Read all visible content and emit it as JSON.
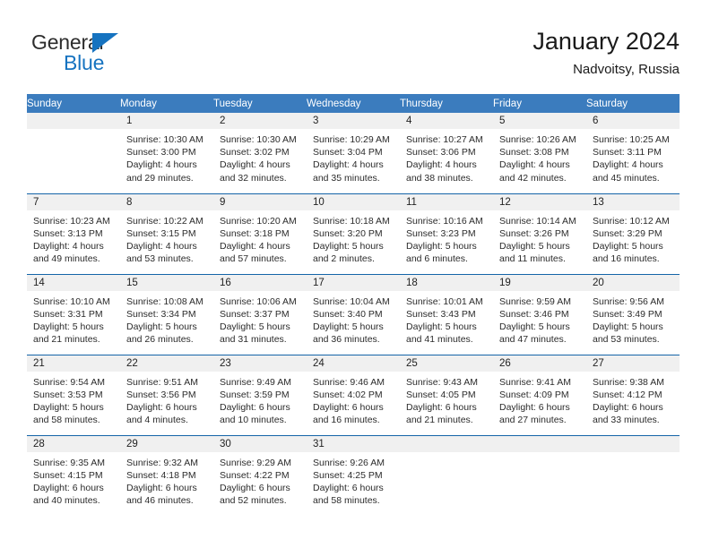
{
  "brand": {
    "line1": "General",
    "line2": "Blue",
    "accent_color": "#1673c0",
    "triangle_icon": "brand-triangle-icon"
  },
  "header": {
    "title": "January 2024",
    "subtitle": "Nadvoitsy, Russia"
  },
  "calendar": {
    "header_bg": "#3b7cbe",
    "row_divider_color": "#1565a8",
    "daynum_band_bg": "#f0f0f0",
    "weekday_headers": [
      "Sunday",
      "Monday",
      "Tuesday",
      "Wednesday",
      "Thursday",
      "Friday",
      "Saturday"
    ],
    "labels": {
      "sunrise": "Sunrise:",
      "sunset": "Sunset:",
      "daylight": "Daylight:"
    },
    "weeks": [
      [
        {
          "day": "",
          "empty": true
        },
        {
          "day": "1",
          "sunrise": "Sunrise: 10:30 AM",
          "sunset": "Sunset: 3:00 PM",
          "daylight_1": "Daylight: 4 hours",
          "daylight_2": "and 29 minutes."
        },
        {
          "day": "2",
          "sunrise": "Sunrise: 10:30 AM",
          "sunset": "Sunset: 3:02 PM",
          "daylight_1": "Daylight: 4 hours",
          "daylight_2": "and 32 minutes."
        },
        {
          "day": "3",
          "sunrise": "Sunrise: 10:29 AM",
          "sunset": "Sunset: 3:04 PM",
          "daylight_1": "Daylight: 4 hours",
          "daylight_2": "and 35 minutes."
        },
        {
          "day": "4",
          "sunrise": "Sunrise: 10:27 AM",
          "sunset": "Sunset: 3:06 PM",
          "daylight_1": "Daylight: 4 hours",
          "daylight_2": "and 38 minutes."
        },
        {
          "day": "5",
          "sunrise": "Sunrise: 10:26 AM",
          "sunset": "Sunset: 3:08 PM",
          "daylight_1": "Daylight: 4 hours",
          "daylight_2": "and 42 minutes."
        },
        {
          "day": "6",
          "sunrise": "Sunrise: 10:25 AM",
          "sunset": "Sunset: 3:11 PM",
          "daylight_1": "Daylight: 4 hours",
          "daylight_2": "and 45 minutes."
        }
      ],
      [
        {
          "day": "7",
          "sunrise": "Sunrise: 10:23 AM",
          "sunset": "Sunset: 3:13 PM",
          "daylight_1": "Daylight: 4 hours",
          "daylight_2": "and 49 minutes."
        },
        {
          "day": "8",
          "sunrise": "Sunrise: 10:22 AM",
          "sunset": "Sunset: 3:15 PM",
          "daylight_1": "Daylight: 4 hours",
          "daylight_2": "and 53 minutes."
        },
        {
          "day": "9",
          "sunrise": "Sunrise: 10:20 AM",
          "sunset": "Sunset: 3:18 PM",
          "daylight_1": "Daylight: 4 hours",
          "daylight_2": "and 57 minutes."
        },
        {
          "day": "10",
          "sunrise": "Sunrise: 10:18 AM",
          "sunset": "Sunset: 3:20 PM",
          "daylight_1": "Daylight: 5 hours",
          "daylight_2": "and 2 minutes."
        },
        {
          "day": "11",
          "sunrise": "Sunrise: 10:16 AM",
          "sunset": "Sunset: 3:23 PM",
          "daylight_1": "Daylight: 5 hours",
          "daylight_2": "and 6 minutes."
        },
        {
          "day": "12",
          "sunrise": "Sunrise: 10:14 AM",
          "sunset": "Sunset: 3:26 PM",
          "daylight_1": "Daylight: 5 hours",
          "daylight_2": "and 11 minutes."
        },
        {
          "day": "13",
          "sunrise": "Sunrise: 10:12 AM",
          "sunset": "Sunset: 3:29 PM",
          "daylight_1": "Daylight: 5 hours",
          "daylight_2": "and 16 minutes."
        }
      ],
      [
        {
          "day": "14",
          "sunrise": "Sunrise: 10:10 AM",
          "sunset": "Sunset: 3:31 PM",
          "daylight_1": "Daylight: 5 hours",
          "daylight_2": "and 21 minutes."
        },
        {
          "day": "15",
          "sunrise": "Sunrise: 10:08 AM",
          "sunset": "Sunset: 3:34 PM",
          "daylight_1": "Daylight: 5 hours",
          "daylight_2": "and 26 minutes."
        },
        {
          "day": "16",
          "sunrise": "Sunrise: 10:06 AM",
          "sunset": "Sunset: 3:37 PM",
          "daylight_1": "Daylight: 5 hours",
          "daylight_2": "and 31 minutes."
        },
        {
          "day": "17",
          "sunrise": "Sunrise: 10:04 AM",
          "sunset": "Sunset: 3:40 PM",
          "daylight_1": "Daylight: 5 hours",
          "daylight_2": "and 36 minutes."
        },
        {
          "day": "18",
          "sunrise": "Sunrise: 10:01 AM",
          "sunset": "Sunset: 3:43 PM",
          "daylight_1": "Daylight: 5 hours",
          "daylight_2": "and 41 minutes."
        },
        {
          "day": "19",
          "sunrise": "Sunrise: 9:59 AM",
          "sunset": "Sunset: 3:46 PM",
          "daylight_1": "Daylight: 5 hours",
          "daylight_2": "and 47 minutes."
        },
        {
          "day": "20",
          "sunrise": "Sunrise: 9:56 AM",
          "sunset": "Sunset: 3:49 PM",
          "daylight_1": "Daylight: 5 hours",
          "daylight_2": "and 53 minutes."
        }
      ],
      [
        {
          "day": "21",
          "sunrise": "Sunrise: 9:54 AM",
          "sunset": "Sunset: 3:53 PM",
          "daylight_1": "Daylight: 5 hours",
          "daylight_2": "and 58 minutes."
        },
        {
          "day": "22",
          "sunrise": "Sunrise: 9:51 AM",
          "sunset": "Sunset: 3:56 PM",
          "daylight_1": "Daylight: 6 hours",
          "daylight_2": "and 4 minutes."
        },
        {
          "day": "23",
          "sunrise": "Sunrise: 9:49 AM",
          "sunset": "Sunset: 3:59 PM",
          "daylight_1": "Daylight: 6 hours",
          "daylight_2": "and 10 minutes."
        },
        {
          "day": "24",
          "sunrise": "Sunrise: 9:46 AM",
          "sunset": "Sunset: 4:02 PM",
          "daylight_1": "Daylight: 6 hours",
          "daylight_2": "and 16 minutes."
        },
        {
          "day": "25",
          "sunrise": "Sunrise: 9:43 AM",
          "sunset": "Sunset: 4:05 PM",
          "daylight_1": "Daylight: 6 hours",
          "daylight_2": "and 21 minutes."
        },
        {
          "day": "26",
          "sunrise": "Sunrise: 9:41 AM",
          "sunset": "Sunset: 4:09 PM",
          "daylight_1": "Daylight: 6 hours",
          "daylight_2": "and 27 minutes."
        },
        {
          "day": "27",
          "sunrise": "Sunrise: 9:38 AM",
          "sunset": "Sunset: 4:12 PM",
          "daylight_1": "Daylight: 6 hours",
          "daylight_2": "and 33 minutes."
        }
      ],
      [
        {
          "day": "28",
          "sunrise": "Sunrise: 9:35 AM",
          "sunset": "Sunset: 4:15 PM",
          "daylight_1": "Daylight: 6 hours",
          "daylight_2": "and 40 minutes."
        },
        {
          "day": "29",
          "sunrise": "Sunrise: 9:32 AM",
          "sunset": "Sunset: 4:18 PM",
          "daylight_1": "Daylight: 6 hours",
          "daylight_2": "and 46 minutes."
        },
        {
          "day": "30",
          "sunrise": "Sunrise: 9:29 AM",
          "sunset": "Sunset: 4:22 PM",
          "daylight_1": "Daylight: 6 hours",
          "daylight_2": "and 52 minutes."
        },
        {
          "day": "31",
          "sunrise": "Sunrise: 9:26 AM",
          "sunset": "Sunset: 4:25 PM",
          "daylight_1": "Daylight: 6 hours",
          "daylight_2": "and 58 minutes."
        },
        {
          "day": "",
          "empty": true
        },
        {
          "day": "",
          "empty": true
        },
        {
          "day": "",
          "empty": true
        }
      ]
    ]
  }
}
